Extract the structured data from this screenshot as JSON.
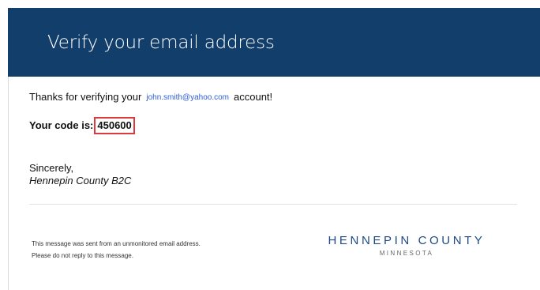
{
  "header": {
    "title": "Verify your email address"
  },
  "body": {
    "thanks_prefix": "Thanks for verifying your",
    "email": "john.smith@yahoo.com",
    "thanks_suffix": "account!",
    "code_label": "Your code is:",
    "code_value": "450600",
    "closing": "Sincerely,",
    "signature": "Hennepin County B2C"
  },
  "footer": {
    "note_line_1": "This message was sent from an unmonitored email address.",
    "note_line_2": "Please do not reply to this message.",
    "logo_main": "HENNEPIN COUNTY",
    "logo_sub": "MINNESOTA"
  },
  "colors": {
    "header_background": "#123e6b",
    "email_link": "#2e5fd8",
    "code_highlight": "#e0393b",
    "logo_text": "#1e4a86"
  }
}
